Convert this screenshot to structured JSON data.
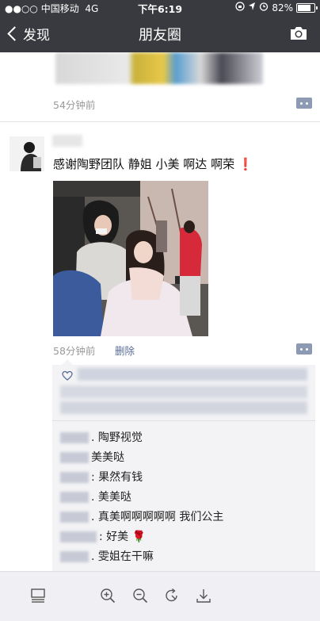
{
  "status_bar": {
    "carrier": "●●○○ 中国移动",
    "network": "4G",
    "time": "下午6:19",
    "battery": "82%",
    "battery_level": 0.82
  },
  "nav": {
    "back_label": "发现",
    "title": "朋友圈"
  },
  "prev_post": {
    "time": "54分钟前"
  },
  "post": {
    "text": "感谢陶野团队 静姐 小美 啊达 啊荣",
    "exclaim": "❗",
    "time": "58分钟前",
    "delete_label": "删除"
  },
  "comments": [
    {
      "text": ". 陶野视觉"
    },
    {
      "text": "美美哒"
    },
    {
      "text": ": 果然有钱"
    },
    {
      "text": ". 美美哒"
    },
    {
      "text": ". 真美啊啊啊啊啊 我们公主"
    },
    {
      "text": ": 好美 🌹"
    },
    {
      "text": ". 雯姐在干嘛"
    }
  ],
  "toolbar": {
    "icons": [
      "layout-icon",
      "zoom-in-icon",
      "zoom-out-icon",
      "rotate-icon",
      "download-icon"
    ]
  },
  "colors": {
    "nav_bg": "#393a3f",
    "link": "#576b95",
    "comment_bg": "#f3f3f5"
  }
}
